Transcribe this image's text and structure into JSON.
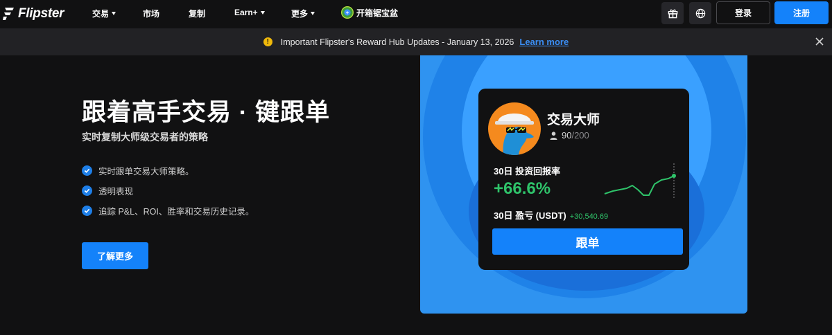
{
  "brand": {
    "name": "Flipster",
    "accent": "#1482fa"
  },
  "nav": {
    "items": [
      {
        "label": "交易",
        "dropdown": true
      },
      {
        "label": "市场",
        "dropdown": false
      },
      {
        "label": "复制",
        "dropdown": false
      },
      {
        "label": "Earn+",
        "dropdown": true
      },
      {
        "label": "更多",
        "dropdown": true
      }
    ],
    "treasure_label": "开箱锯宝盆",
    "gift_icon": "gift-icon",
    "globe_icon": "globe-icon",
    "login_label": "登录",
    "signup_label": "注册"
  },
  "banner": {
    "text": "Important Flipster's Reward Hub Updates - January 13, 2026",
    "link_label": "Learn more"
  },
  "hero": {
    "title": "跟着高手交易 · 键跟单",
    "subtitle": "实时复制大师级交易者的策略",
    "bullets": [
      "实时跟单交易大师策略。",
      "透明表现",
      "追踪 P&L、ROI、胜率和交易历史记录。"
    ],
    "cta_label": "了解更多"
  },
  "card": {
    "trader_name": "交易大师",
    "followers_current": "90",
    "followers_max": "/200",
    "roi_label": "30日 投资回报率",
    "roi_value": "+66.6%",
    "pnl_label": "30日 盈亏 (USDT)",
    "pnl_value": "+30,540.69",
    "follow_label": "跟单",
    "positive_color": "#2fc36a"
  }
}
